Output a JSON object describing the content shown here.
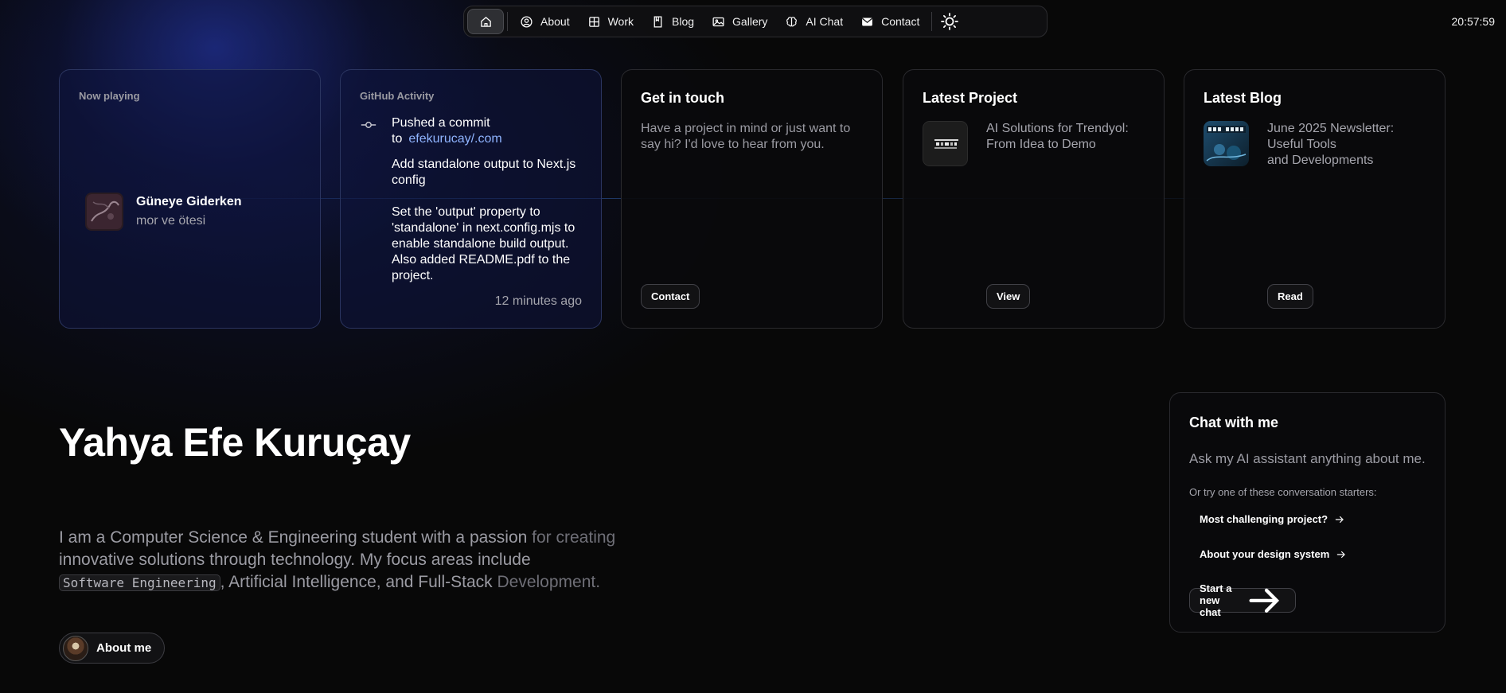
{
  "nav": {
    "home_icon": "home-icon",
    "items": [
      {
        "label": "About",
        "icon": "user-circle-icon"
      },
      {
        "label": "Work",
        "icon": "grid-icon"
      },
      {
        "label": "Blog",
        "icon": "book-icon"
      },
      {
        "label": "Gallery",
        "icon": "image-icon"
      },
      {
        "label": "AI Chat",
        "icon": "brain-icon"
      },
      {
        "label": "Contact",
        "icon": "envelope-icon"
      }
    ],
    "theme_icon": "sun-icon"
  },
  "clock": "20:57:59",
  "now_playing": {
    "label": "Now playing",
    "title": "Güneye Giderken",
    "artist": "mor ve ötesi"
  },
  "github": {
    "label": "GitHub Activity",
    "action": "Pushed a commit",
    "to_word": "to",
    "repo": "efekurucay/.com",
    "commit_title": "Add standalone output to Next.js config",
    "commit_body": "Set the 'output' property to 'standalone' in next.config.mjs to enable standalone build output. Also added README.pdf to the project.",
    "time": "12 minutes ago"
  },
  "contact_card": {
    "title": "Get in touch",
    "text": "Have a project in mind or just want to say hi? I'd love to hear from you.",
    "button": "Contact"
  },
  "project_card": {
    "title": "Latest Project",
    "text": "AI Solutions for Trendyol: From Idea to Demo",
    "button": "View"
  },
  "blog_card": {
    "title": "Latest Blog",
    "line1": "June 2025 Newsletter: Useful Tools",
    "line2": "and Developments",
    "button": "Read"
  },
  "hero": {
    "name": "Yahya Efe Kuruçay",
    "bio_start": "I am a Computer Science & Engineering student with a passion ",
    "bio_fade1": "for creating",
    "bio_mid": "innovative solutions through technology. My focus areas include",
    "code": "Software Engineering",
    "bio_end": ", Artificial Intelligence, and Full-Stack ",
    "bio_fade2": "Development.",
    "about_button": "About me"
  },
  "chat": {
    "title": "Chat with me",
    "subtitle": "Ask my AI assistant anything about me.",
    "hint": "Or try one of these conversation starters:",
    "starters": [
      "Most challenging project?",
      "About your design system"
    ],
    "new_chat": "Start a new chat"
  }
}
